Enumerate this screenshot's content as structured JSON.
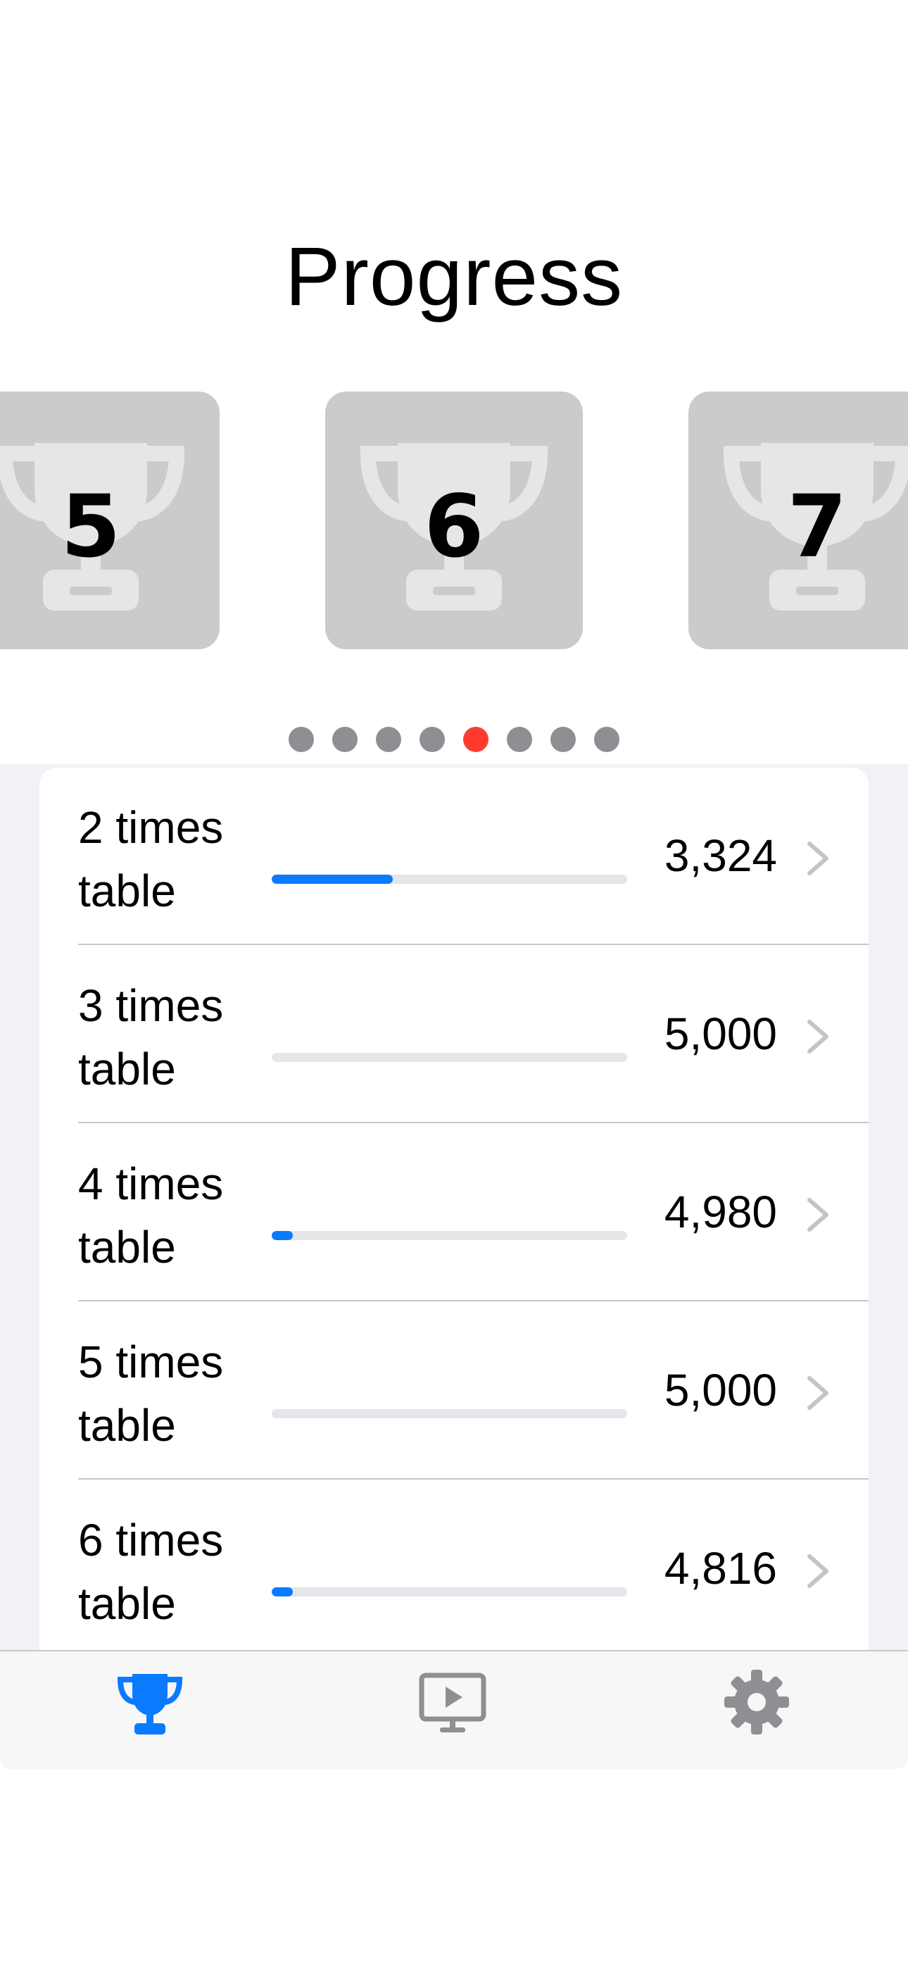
{
  "header": {
    "title": "Progress"
  },
  "carousel": {
    "cards": [
      {
        "number": "5"
      },
      {
        "number": "6"
      },
      {
        "number": "7"
      }
    ],
    "page_count": 8,
    "active_page_index": 4,
    "active_color": "#ff3b30",
    "inactive_color": "#8e8e93"
  },
  "tables": [
    {
      "label": "2 times table",
      "value": "3,324",
      "progress": 0.34
    },
    {
      "label": "3 times table",
      "value": "5,000",
      "progress": 0.0
    },
    {
      "label": "4 times table",
      "value": "4,980",
      "progress": 0.06
    },
    {
      "label": "5 times table",
      "value": "5,000",
      "progress": 0.0
    },
    {
      "label": "6 times table",
      "value": "4,816",
      "progress": 0.06
    }
  ],
  "tabbar": {
    "tabs": [
      {
        "icon": "trophy-icon",
        "selected": true
      },
      {
        "icon": "tv-play-icon",
        "selected": false
      },
      {
        "icon": "gear-icon",
        "selected": false
      }
    ],
    "accent_color": "#0a7aff",
    "inactive_color": "#8e8e93"
  }
}
